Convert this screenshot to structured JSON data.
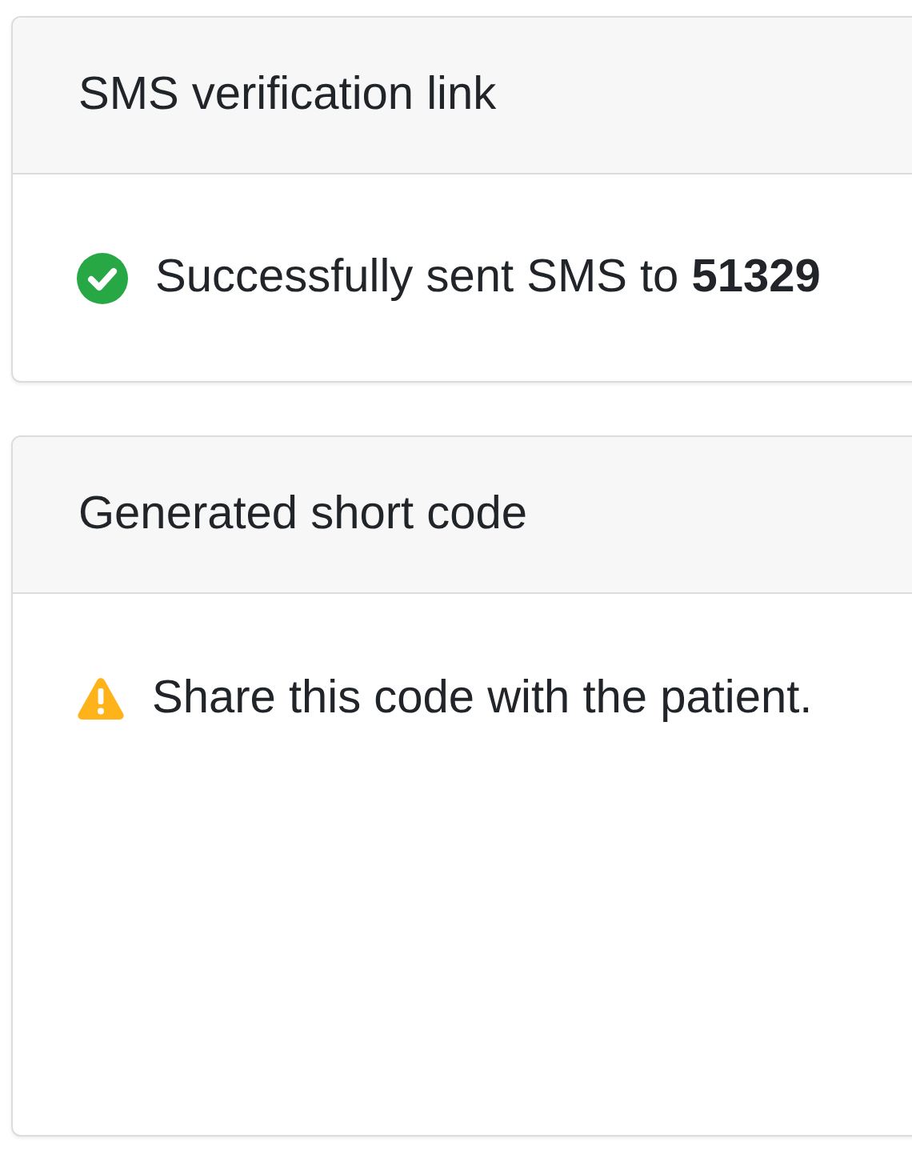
{
  "cards": [
    {
      "title": "SMS verification link",
      "message": {
        "kind": "success",
        "text": "Successfully sent SMS to **51329**"
      }
    },
    {
      "title": "Generated short code",
      "message": {
        "kind": "warning",
        "text": "Share this code with the patient."
      }
    }
  ]
}
